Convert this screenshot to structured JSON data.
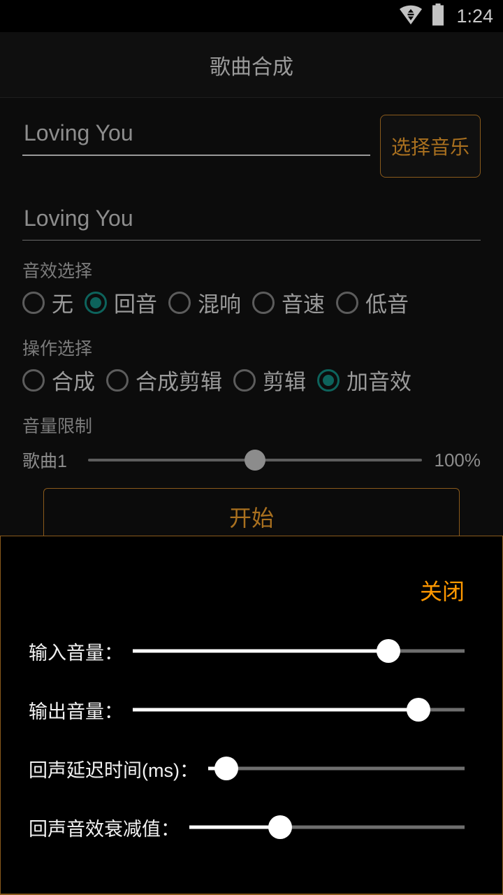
{
  "status_bar": {
    "wifi_icon": "wifi-data-icon",
    "battery_icon": "battery-icon",
    "time": "1:24"
  },
  "title_bar": {
    "title": "歌曲合成"
  },
  "form": {
    "song_field_1": {
      "value": "Loving You",
      "placeholder": "Loving You"
    },
    "song_field_2": {
      "value": "Loving You",
      "placeholder": "Loving You"
    },
    "pick_music_button": "选择音乐"
  },
  "effect_section": {
    "label": "音效选择",
    "options": [
      {
        "label": "无",
        "checked": false
      },
      {
        "label": "回音",
        "checked": true
      },
      {
        "label": "混响",
        "checked": false
      },
      {
        "label": "音速",
        "checked": false
      },
      {
        "label": "低音",
        "checked": false
      }
    ]
  },
  "operation_section": {
    "label": "操作选择",
    "options": [
      {
        "label": "合成",
        "checked": false
      },
      {
        "label": "合成剪辑",
        "checked": false
      },
      {
        "label": "剪辑",
        "checked": false
      },
      {
        "label": "加音效",
        "checked": true
      }
    ]
  },
  "volume_section": {
    "label": "音量限制",
    "slider": {
      "name": "歌曲1",
      "value_text": "100%",
      "percent": 50
    }
  },
  "start_button": "开始",
  "effect_panel": {
    "close_button": "关闭",
    "sliders": [
      {
        "label": "输入音量：",
        "percent": 77
      },
      {
        "label": "输出音量：",
        "percent": 86
      },
      {
        "label": "回声延迟时间(ms)：",
        "percent": 7
      },
      {
        "label": "回声音效衰减值：",
        "percent": 33
      }
    ]
  },
  "colors": {
    "accent_orange": "#ff9800",
    "border_amber": "#8a5a1c",
    "radio_checked_teal": "#0d635c",
    "background": "#0c0c0c",
    "panel_background": "#000000"
  }
}
